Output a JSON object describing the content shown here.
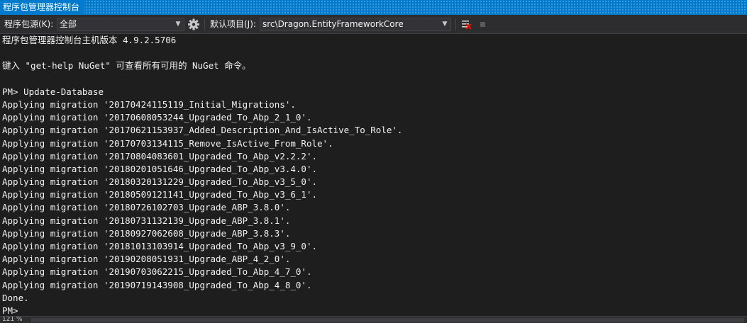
{
  "window": {
    "title": "程序包管理器控制台"
  },
  "toolbar": {
    "source_label": "程序包源(K):",
    "source_value": "全部",
    "default_project_label": "默认项目(J):",
    "default_project_value": "src\\Dragon.EntityFrameworkCore",
    "settings_icon": "gear-icon",
    "clear_icon": "clear-console-icon",
    "stop_icon": "stop-icon"
  },
  "console": {
    "lines": [
      "程序包管理器控制台主机版本 4.9.2.5706",
      "",
      "键入 \"get-help NuGet\" 可查看所有可用的 NuGet 命令。",
      "",
      "PM> Update-Database",
      "Applying migration '20170424115119_Initial_Migrations'.",
      "Applying migration '20170608053244_Upgraded_To_Abp_2_1_0'.",
      "Applying migration '20170621153937_Added_Description_And_IsActive_To_Role'.",
      "Applying migration '20170703134115_Remove_IsActive_From_Role'.",
      "Applying migration '20170804083601_Upgraded_To_Abp_v2.2.2'.",
      "Applying migration '20180201051646_Upgraded_To_Abp_v3.4.0'.",
      "Applying migration '20180320131229_Upgraded_To_Abp_v3_5_0'.",
      "Applying migration '20180509121141_Upgraded_To_Abp_v3_6_1'.",
      "Applying migration '20180726102703_Upgrade_ABP_3.8.0'.",
      "Applying migration '20180731132139_Upgrade_ABP_3.8.1'.",
      "Applying migration '20180927062608_Upgrade_ABP_3.8.3'.",
      "Applying migration '20181013103914_Upgraded_To_Abp_v3_9_0'.",
      "Applying migration '20190208051931_Upgrade_ABP_4_2_0'.",
      "Applying migration '20190703062215_Upgraded_To_Abp_4_7_0'.",
      "Applying migration '20190719143908_Upgraded_To_Abp_4_8_0'.",
      "Done.",
      "PM>"
    ]
  },
  "statusbar": {
    "zoom": "121 %"
  },
  "colors": {
    "accent": "#007acc",
    "background": "#1e1e1e",
    "toolbar": "#2d2d30",
    "text": "#f1f1f1",
    "clear_icon_red": "#e51400"
  }
}
